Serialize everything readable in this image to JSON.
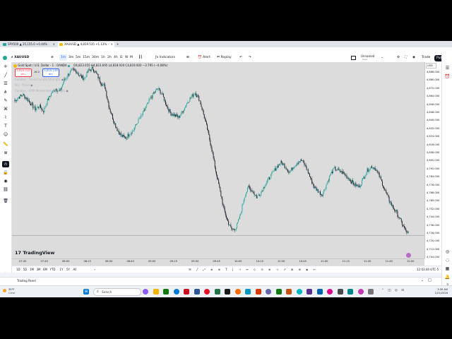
{
  "browser": {
    "tabs": [
      {
        "label": "SPX500 ▲ 25,155.0 +0.44% ·",
        "active": false,
        "color": "#26a69a"
      },
      {
        "label": "XAUUSD ▲ 4,819.535 +1.13% ·",
        "active": true,
        "color": "#f0b90b"
      }
    ],
    "new_tab": "+"
  },
  "toolbar": {
    "symbol": "XAUUSD",
    "intervals": [
      "1m",
      "3m",
      "5m",
      "15m",
      "30m",
      "1h",
      "2h",
      "4h",
      "D",
      "W",
      "M"
    ],
    "active_interval": "1m",
    "indicators_label": "Indicators",
    "alert_label": "Alert",
    "replay_label": "Replay",
    "layout_name": "Unnamed",
    "layout_sub": "Save",
    "trade_label": "Trade",
    "publish_label": "Publish",
    "currency": "USD"
  },
  "legend": {
    "title": "Gold Spot / U.S. Dollar · 1 · OANDA",
    "ohlc": "O4,823.055  H4,823.695  L4,818.920  C4,819.920  −3.795 (−0.08%)",
    "sell_price": "4,819.519",
    "sell_label": "SELL",
    "spread": "16.2",
    "buy_price": "4,819.149",
    "buy_label": "BUY",
    "indicator_rows": [
      "Candles · Trend Candle Strength",
      "Vol · Trend",
      "Candles · EMA Momentum Strength"
    ]
  },
  "price_axis": {
    "labels": [
      "4,888.000",
      "4,880.000",
      "4,872.000",
      "4,864.000",
      "4,856.000",
      "4,848.000",
      "4,840.000",
      "4,832.000",
      "4,824.000",
      "4,816.000",
      "4,808.000",
      "4,800.000",
      "4,792.000",
      "4,784.000",
      "4,776.000",
      "4,768.000",
      "4,760.000",
      "4,752.000",
      "4,744.000",
      "4,736.000",
      "4,728.000",
      "4,720.000",
      "4,712.000",
      "4,704.000"
    ],
    "last_symbol": "XAUUSD",
    "last_price": "4,819.920",
    "countdown": "00:16",
    "line_label": "4,818.9"
  },
  "time_axis": [
    "07:30",
    "07:45",
    "08:00",
    "08:15",
    "08:30",
    "08:45",
    "09:00",
    "09:15",
    "09:30",
    "09:45",
    "10:00",
    "10:15",
    "10:30",
    "10:45",
    "11:00",
    "11:15",
    "11:30",
    "11:45",
    "12:00"
  ],
  "chart_data": {
    "type": "candlestick",
    "symbol": "XAUUSD",
    "interval": "1m",
    "ylim": [
      4700,
      4892
    ],
    "close_path": [
      4854,
      4858,
      4860,
      4856,
      4851,
      4846,
      4849,
      4844,
      4855,
      4862,
      4866,
      4863,
      4874,
      4880,
      4884,
      4883,
      4878,
      4876,
      4884,
      4886,
      4880,
      4872,
      4868,
      4848,
      4836,
      4826,
      4820,
      4818,
      4822,
      4826,
      4834,
      4840,
      4848,
      4856,
      4862,
      4866,
      4860,
      4850,
      4842,
      4840,
      4838,
      4844,
      4852,
      4858,
      4862,
      4856,
      4842,
      4826,
      4808,
      4786,
      4768,
      4748,
      4736,
      4728,
      4730,
      4742,
      4760,
      4770,
      4766,
      4760,
      4764,
      4772,
      4778,
      4784,
      4790,
      4794,
      4790,
      4784,
      4790,
      4794,
      4796,
      4790,
      4780,
      4770,
      4766,
      4762,
      4772,
      4782,
      4788,
      4786,
      4784,
      4780,
      4776,
      4772,
      4770,
      4778,
      4786,
      4790,
      4788,
      4780,
      4770,
      4760,
      4752,
      4746,
      4738,
      4730,
      4724
    ]
  },
  "bottombar": {
    "ranges": [
      "1D",
      "5D",
      "1M",
      "3M",
      "6M",
      "YTD",
      "1Y",
      "5Y",
      "All"
    ],
    "clock": "12:03:44 UTC-5"
  },
  "watermark": "TradingView",
  "trading_panel_label": "Trading Panel",
  "taskbar": {
    "weather_temp": "39°F",
    "weather_desc": "Clear",
    "search_placeholder": "Search",
    "time": "3:30 AM",
    "date": "1/22/2026"
  }
}
